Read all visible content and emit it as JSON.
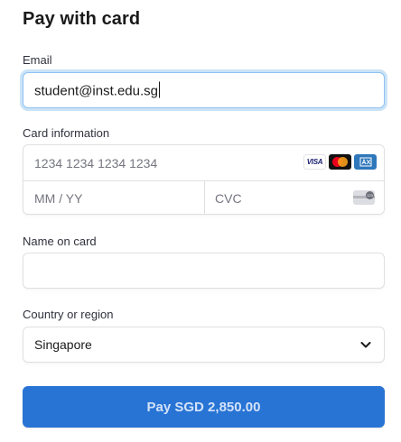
{
  "page": {
    "title": "Pay with card"
  },
  "email": {
    "label": "Email",
    "value": "student@inst.edu.sg"
  },
  "card": {
    "label": "Card information",
    "number_placeholder": "1234 1234 1234 1234",
    "expiry_placeholder": "MM / YY",
    "cvc_placeholder": "CVC",
    "brands": [
      "VISA",
      "mastercard-icon",
      "amex-icon"
    ],
    "brand_visa_text": "VISA"
  },
  "name": {
    "label": "Name on card",
    "value": ""
  },
  "country": {
    "label": "Country or region",
    "selected": "Singapore"
  },
  "pay_button": {
    "label": "Pay SGD 2,850.00",
    "color": "#2874d5"
  },
  "colors": {
    "focus_ring": "#8fc1f2",
    "field_border": "#e0e0e0",
    "placeholder": "#757680"
  }
}
